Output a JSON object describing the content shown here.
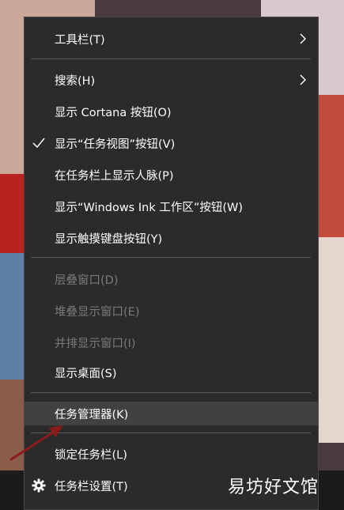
{
  "menu": {
    "items": [
      {
        "label": "工具栏(T)",
        "submenu": true
      },
      {
        "label": "搜索(H)",
        "submenu": true
      },
      {
        "label": "显示 Cortana 按钮(O)"
      },
      {
        "label": "显示“任务视图”按钮(V)",
        "checked": true
      },
      {
        "label": "在任务栏上显示人脉(P)"
      },
      {
        "label": "显示“Windows Ink 工作区”按钮(W)"
      },
      {
        "label": "显示触摸键盘按钮(Y)"
      },
      {
        "label": "层叠窗口(D)",
        "disabled": true
      },
      {
        "label": "堆叠显示窗口(E)",
        "disabled": true
      },
      {
        "label": "并排显示窗口(I)",
        "disabled": true
      },
      {
        "label": "显示桌面(S)"
      },
      {
        "label": "任务管理器(K)",
        "highlighted": true
      },
      {
        "label": "锁定任务栏(L)"
      },
      {
        "label": "任务栏设置(T)",
        "icon": "gear-icon"
      }
    ]
  },
  "watermark": "易坊好文馆",
  "colors": {
    "menu_bg": "#2b2b2b",
    "menu_text": "#ffffff",
    "disabled_text": "#7a7a7a",
    "hover_bg": "#414141",
    "separator": "#5a5a5a",
    "arrow": "#8b1a1a"
  }
}
